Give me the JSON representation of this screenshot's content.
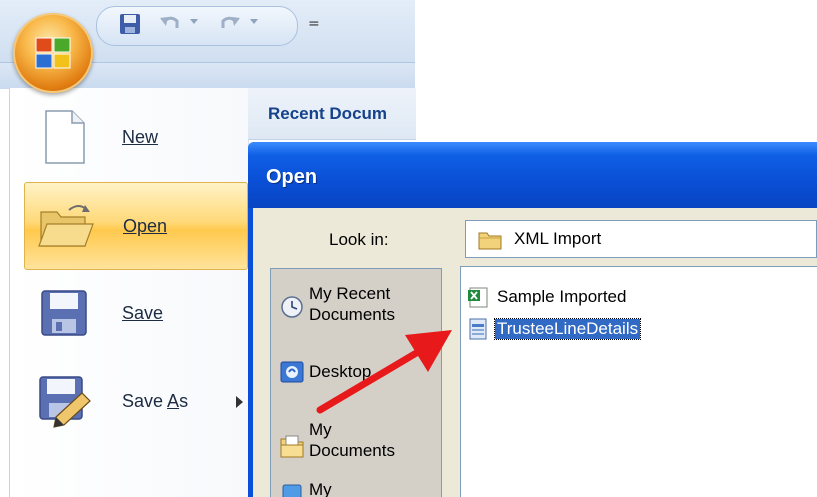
{
  "quick_access": {
    "icons": [
      "office-logo",
      "save-icon",
      "undo-icon",
      "redo-icon",
      "customize-icon"
    ],
    "customize_glyph": "="
  },
  "office_menu": {
    "commands": [
      {
        "label": "New",
        "mnemonic_index": 0
      },
      {
        "label": "Open",
        "mnemonic_index": 0
      },
      {
        "label": "Save",
        "mnemonic_index": 0
      },
      {
        "label": "Save As",
        "mnemonic_index": 5
      }
    ],
    "recent_header": "Recent Docum"
  },
  "open_dialog": {
    "title": "Open",
    "look_in_label": "Look in:",
    "look_in_value": "XML Import",
    "places": [
      {
        "line1": "My Recent",
        "line2": "Documents"
      },
      {
        "line1": "Desktop",
        "line2": ""
      },
      {
        "line1": "My",
        "line2": "Documents"
      },
      {
        "line1": "My",
        "line2": ""
      }
    ],
    "files": [
      {
        "name": "Sample Imported",
        "selected": false,
        "icon": "excel-file-icon"
      },
      {
        "name": "TrusteeLineDetails",
        "selected": true,
        "icon": "xml-file-icon"
      }
    ]
  },
  "colors": {
    "dialog_title": "#0a4fd6",
    "dialog_body": "#ece9d8",
    "selection": "#316ac5",
    "menu_hover": "#ffd97a",
    "arrow": "#e8191b"
  }
}
